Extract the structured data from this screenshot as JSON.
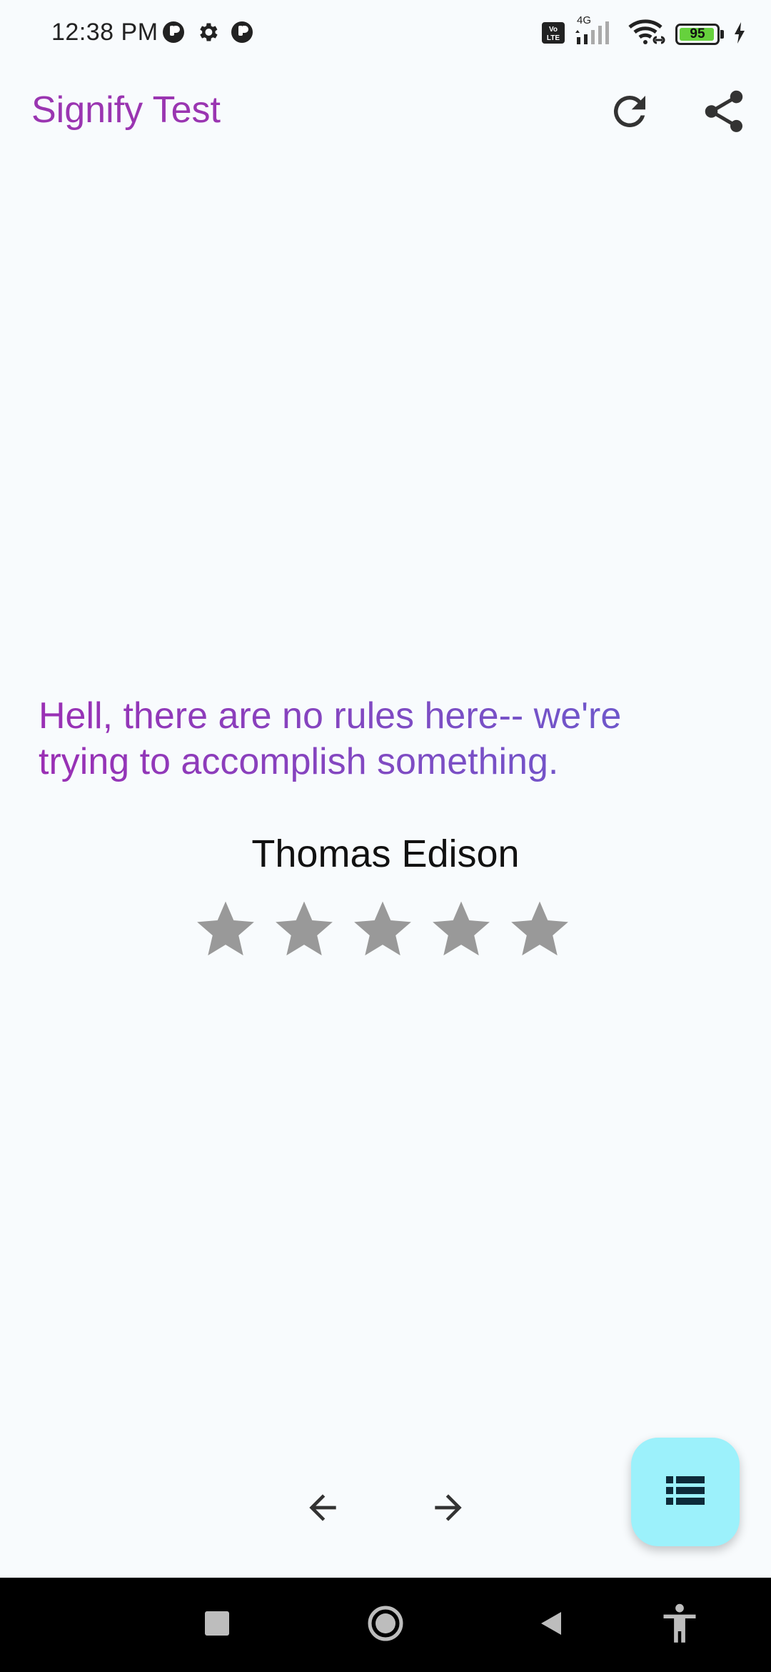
{
  "status_bar": {
    "time": "12:38 PM",
    "network": "4G",
    "volte": "Vo LTE",
    "battery_percent": "95",
    "battery_level": 0.95,
    "battery_color": "#66d13d",
    "left_icons": [
      "app-notification-icon",
      "gear-icon",
      "app-notification-icon"
    ],
    "right_icons": [
      "volte-icon",
      "signal-icon",
      "wifi-icon",
      "battery-icon",
      "charging-icon"
    ]
  },
  "app_bar": {
    "title": "Signify Test",
    "title_color": "#9a35b1",
    "actions": [
      "refresh-icon",
      "share-icon"
    ]
  },
  "quote": {
    "text": "Hell, there are no rules here-- we're trying to accomplish something.",
    "author": "Thomas Edison",
    "rating": {
      "max": 5,
      "value": 0,
      "star_color": "#999999"
    }
  },
  "bottom": {
    "nav": [
      "arrow-left-icon",
      "arrow-right-icon"
    ],
    "fab_icon": "list-icon",
    "fab_color": "#9cf1fb"
  },
  "system_nav": [
    "recents-icon",
    "home-icon",
    "back-icon",
    "accessibility-icon"
  ]
}
